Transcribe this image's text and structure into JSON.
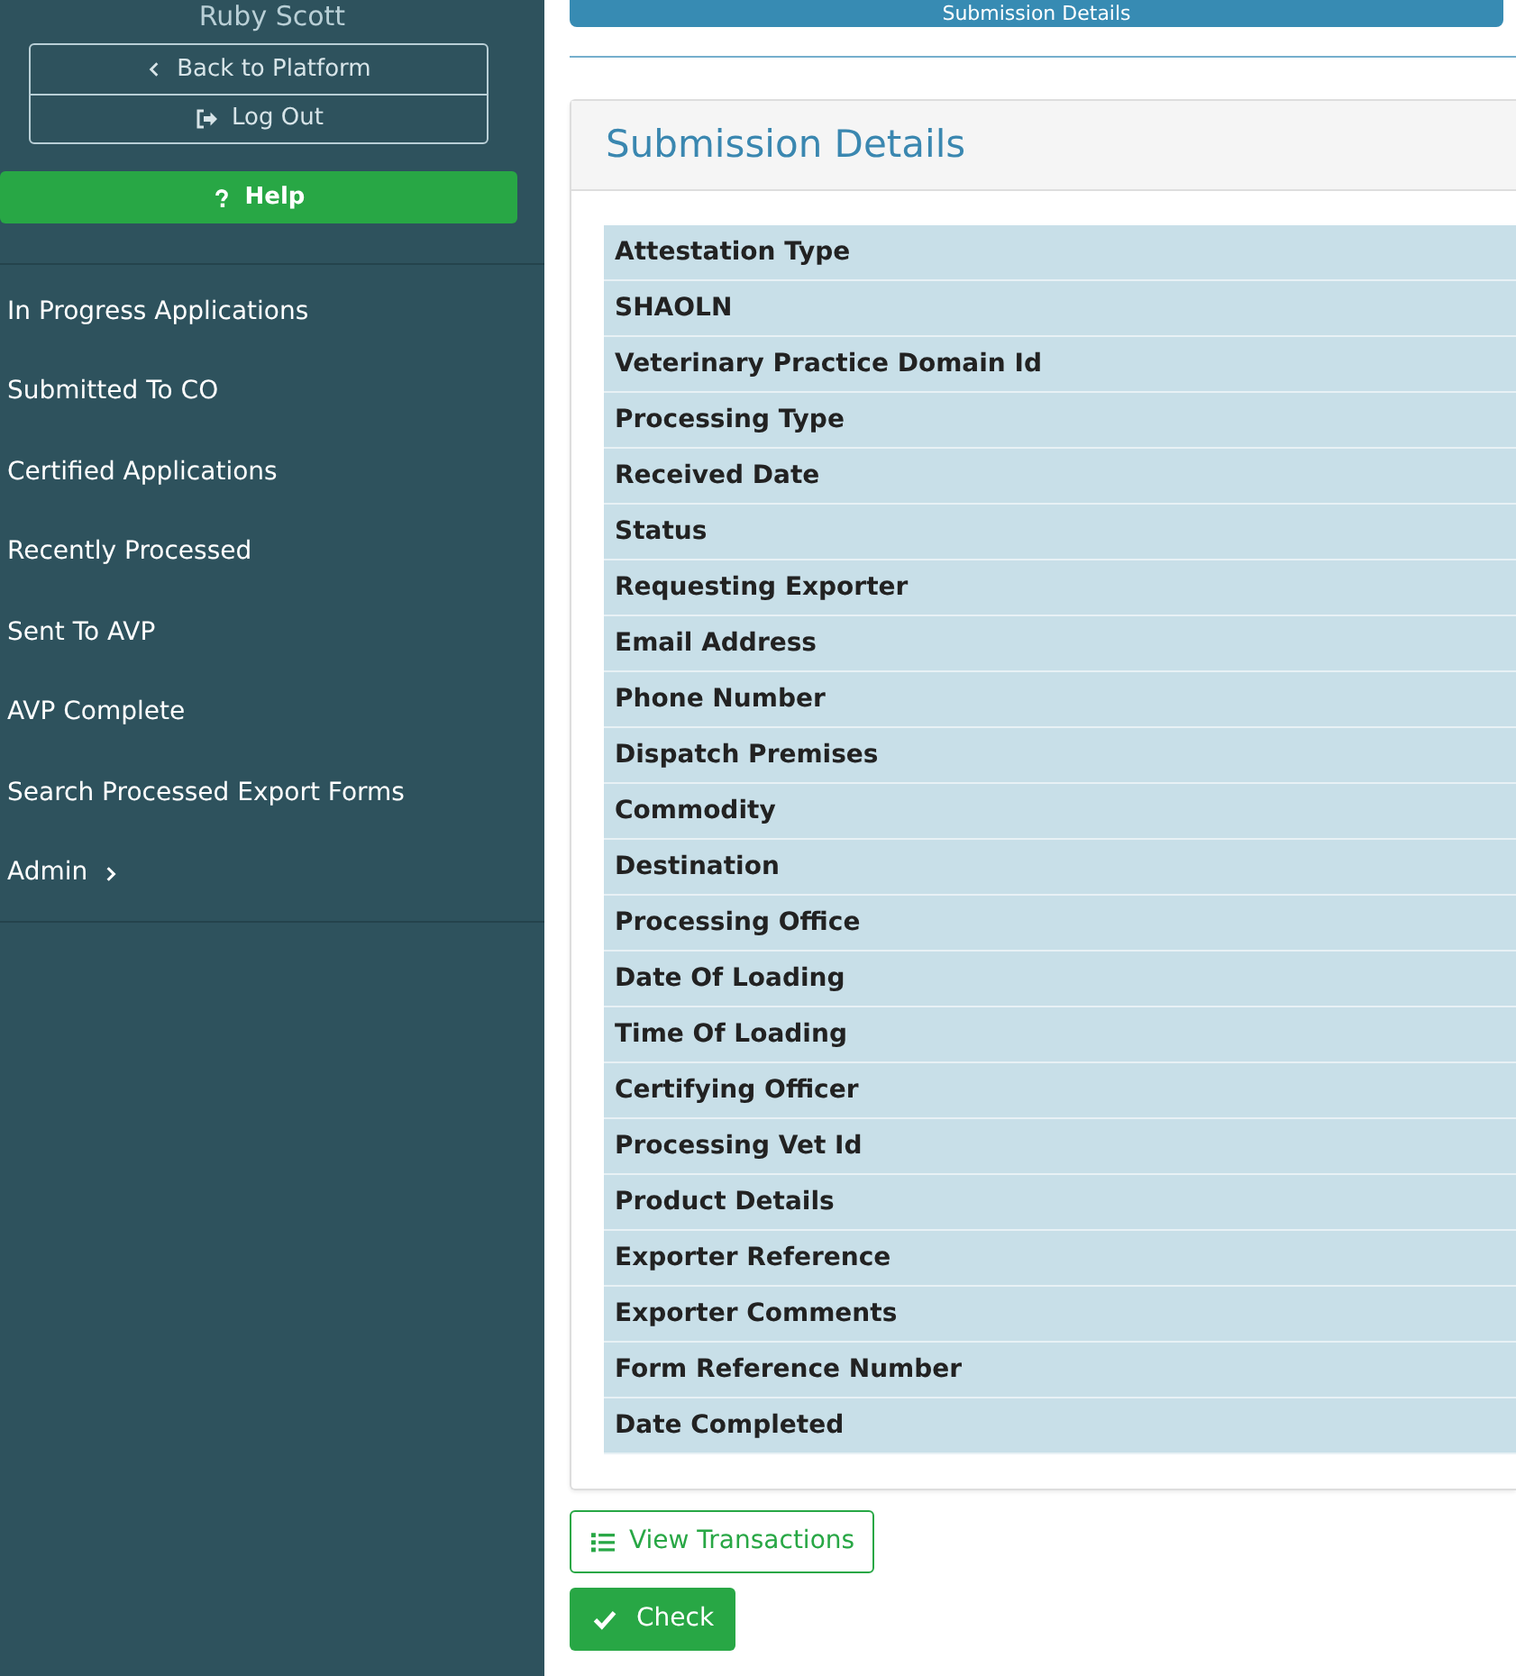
{
  "sidebar": {
    "user_name": "Ruby Scott",
    "account_buttons": [
      {
        "kind": "back",
        "label": "Back to Platform"
      },
      {
        "kind": "logout",
        "label": "Log Out"
      }
    ],
    "help_button": "Help",
    "nav_items": [
      {
        "label": "In Progress Applications",
        "has_submenu": false
      },
      {
        "label": "Submitted To CO",
        "has_submenu": false
      },
      {
        "label": "Certified Applications",
        "has_submenu": false
      },
      {
        "label": "Recently Processed",
        "has_submenu": false
      },
      {
        "label": "Sent To AVP",
        "has_submenu": false
      },
      {
        "label": "AVP Complete",
        "has_submenu": false
      },
      {
        "label": "Search Processed Export Forms",
        "has_submenu": false
      },
      {
        "label": "Admin",
        "has_submenu": true
      }
    ]
  },
  "main": {
    "top_button": "Submission Details",
    "card": {
      "title": "Submission Details",
      "fields": [
        "Attestation Type",
        "SHAOLN",
        "Veterinary Practice Domain Id",
        "Processing Type",
        "Received Date",
        "Status",
        "Requesting Exporter",
        "Email Address",
        "Phone Number",
        "Dispatch Premises",
        "Commodity",
        "Destination",
        "Processing Office",
        "Date Of Loading",
        "Time Of Loading",
        "Certifying Officer",
        "Processing Vet Id",
        "Product Details",
        "Exporter Reference",
        "Exporter Comments",
        "Form Reference Number",
        "Date Completed"
      ]
    },
    "buttons": [
      {
        "kind": "list",
        "label": "View Transactions"
      },
      {
        "kind": "check",
        "label": "Check"
      }
    ]
  }
}
